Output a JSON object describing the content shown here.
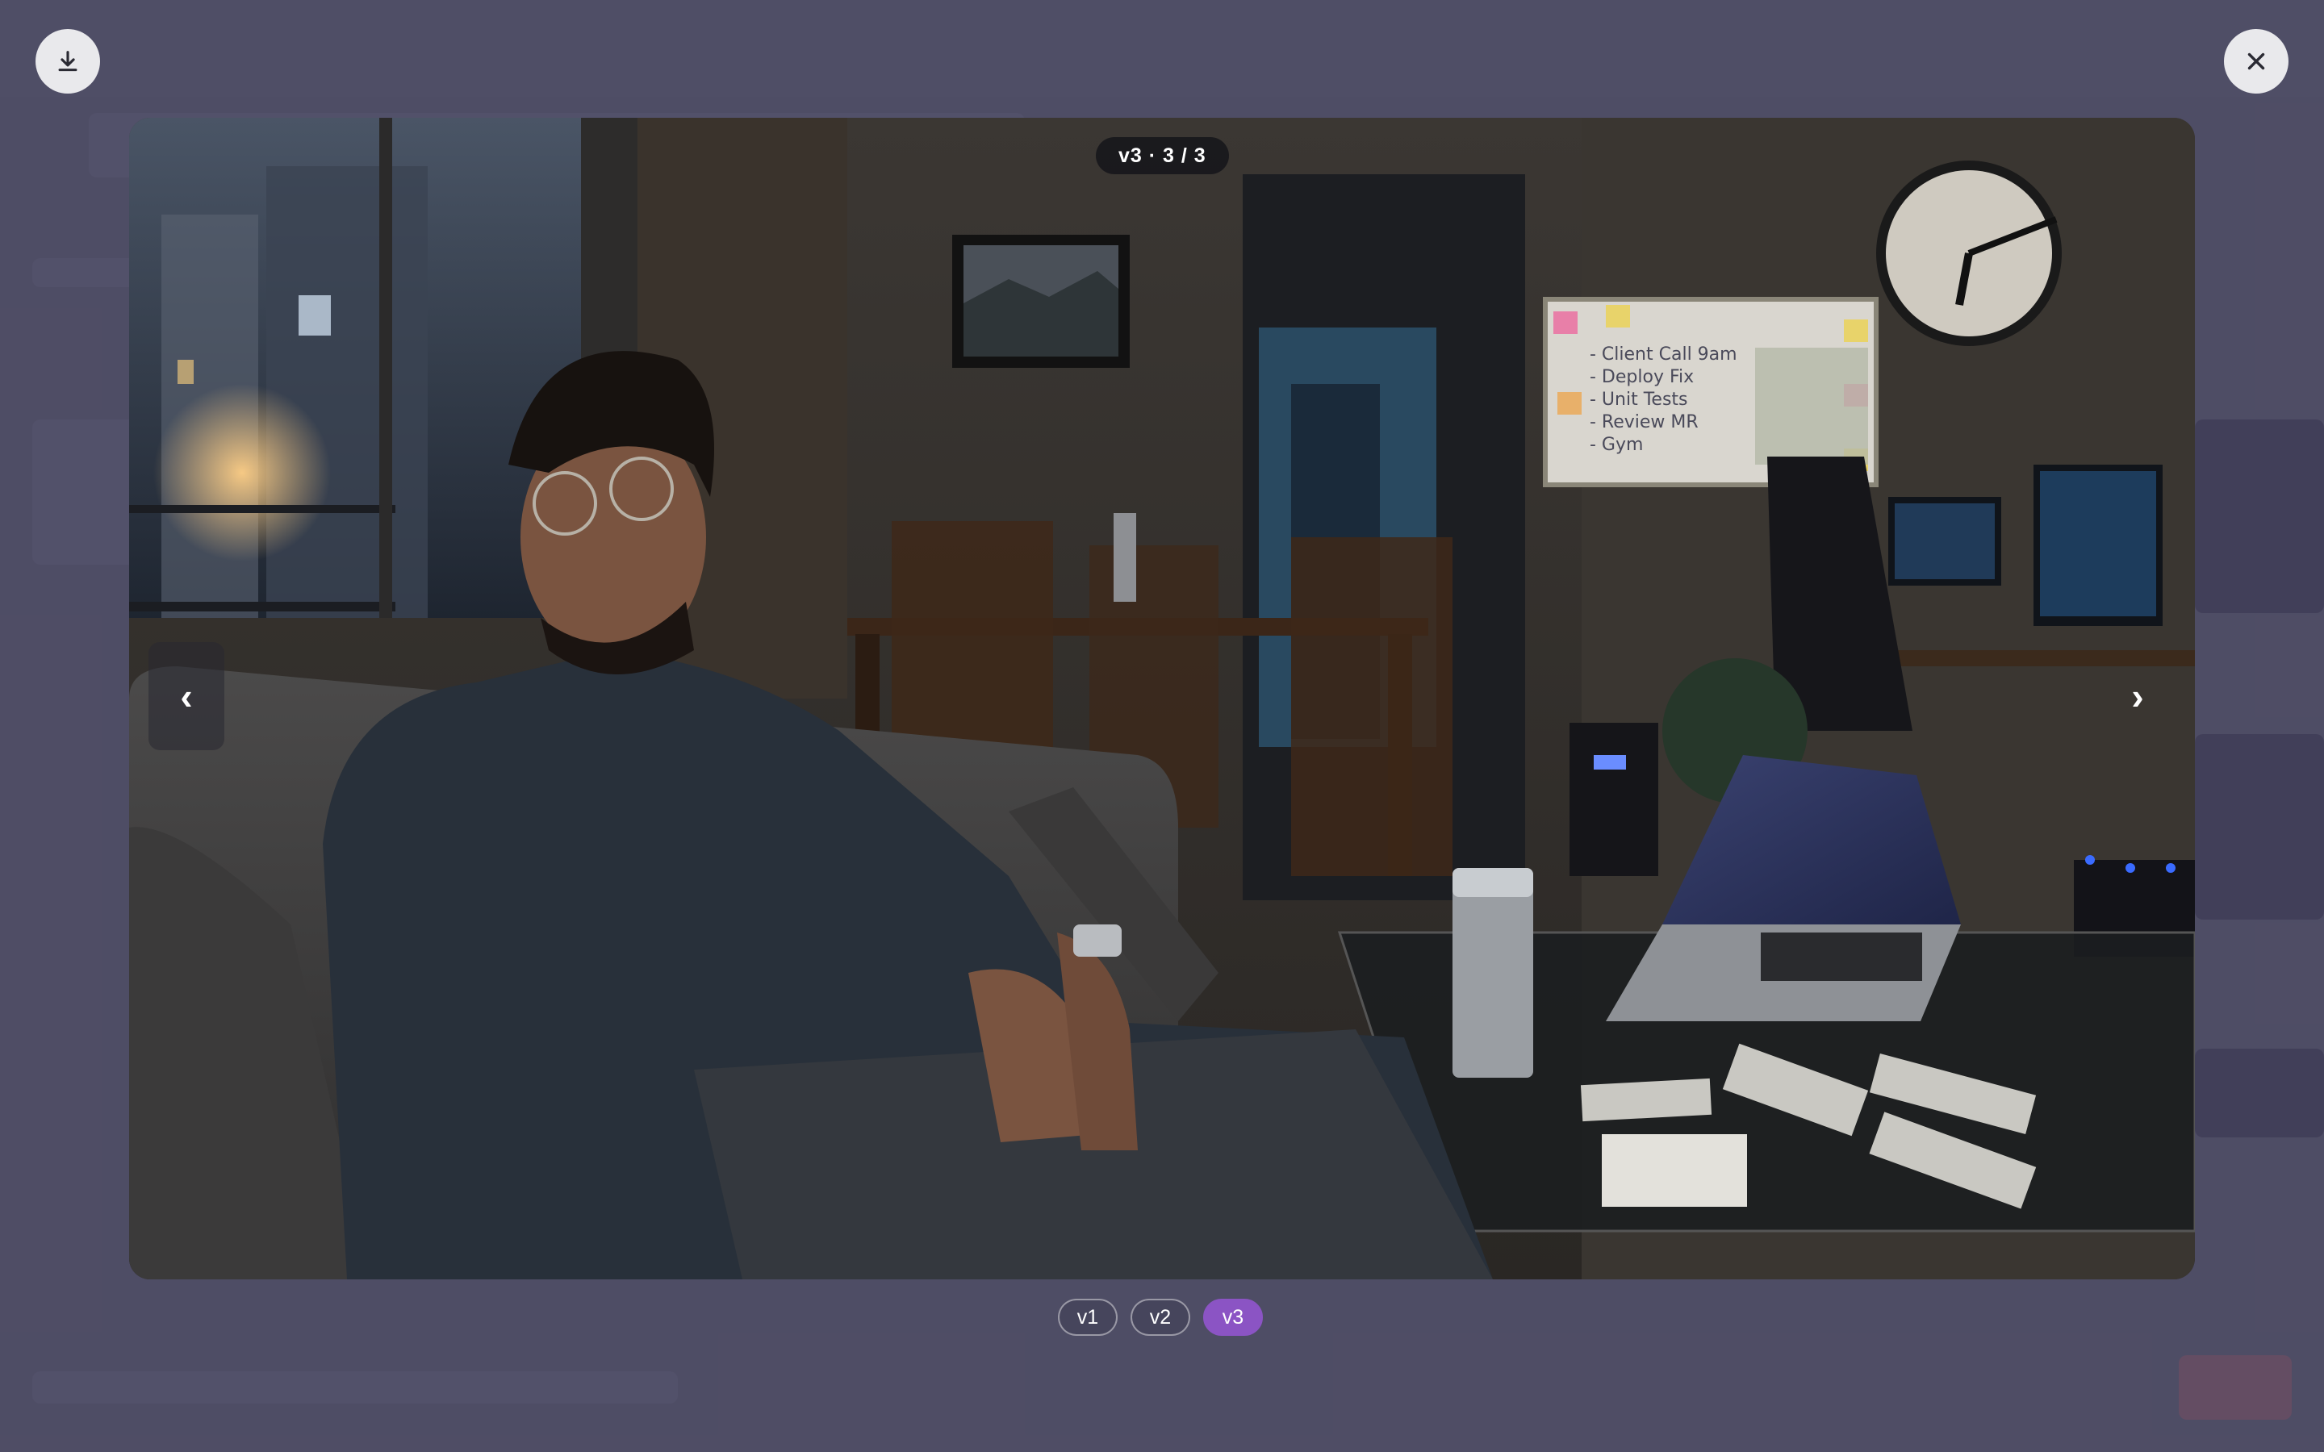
{
  "lightbox": {
    "counter_label": "v3 · 3 / 3",
    "prev_glyph": "‹",
    "next_glyph": "›",
    "download_icon": "download-icon",
    "close_icon": "close-icon",
    "versions": [
      {
        "label": "v1",
        "active": false
      },
      {
        "label": "v2",
        "active": false
      },
      {
        "label": "v3",
        "active": true
      }
    ],
    "accent_color": "#8b54c4"
  },
  "scene": {
    "whiteboard_lines": [
      "- Client Call 9am",
      "- Deploy Fix",
      "- Unit Tests",
      "- Review MR",
      "- Gym"
    ]
  }
}
